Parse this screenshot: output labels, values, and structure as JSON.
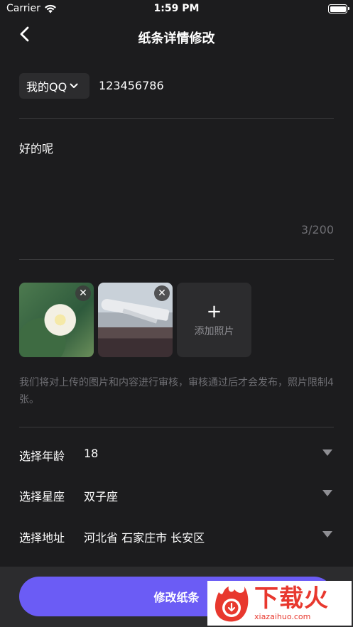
{
  "status_bar": {
    "carrier": "Carrier",
    "time": "1:59 PM",
    "battery_level": 1.0
  },
  "nav": {
    "title": "纸条详情修改",
    "back_icon": "chevron-left-icon"
  },
  "contact": {
    "type_label": "我的QQ",
    "value": "123456786"
  },
  "content": {
    "text": "好的呢",
    "count": "3/200"
  },
  "photos": {
    "items": [
      {
        "name": "lotus-flower-photo"
      },
      {
        "name": "airplane-photo"
      }
    ],
    "remove_label": "✕",
    "add_plus": "+",
    "add_label": "添加照片"
  },
  "notice": "我们将对上传的图片和内容进行审核，审核通过后才会发布，照片限制4张。",
  "fields": {
    "age": {
      "label": "选择年龄",
      "value": "18"
    },
    "zodiac": {
      "label": "选择星座",
      "value": "双子座"
    },
    "address": {
      "label": "选择地址",
      "value": "河北省 石家庄市 长安区"
    }
  },
  "submit_label": "修改纸条",
  "watermark": {
    "text": "下载火",
    "url": "xiazaihuo.com"
  },
  "colors": {
    "background": "#1c1c1e",
    "accent": "#6b5cf5",
    "muted": "#6e6e73"
  }
}
